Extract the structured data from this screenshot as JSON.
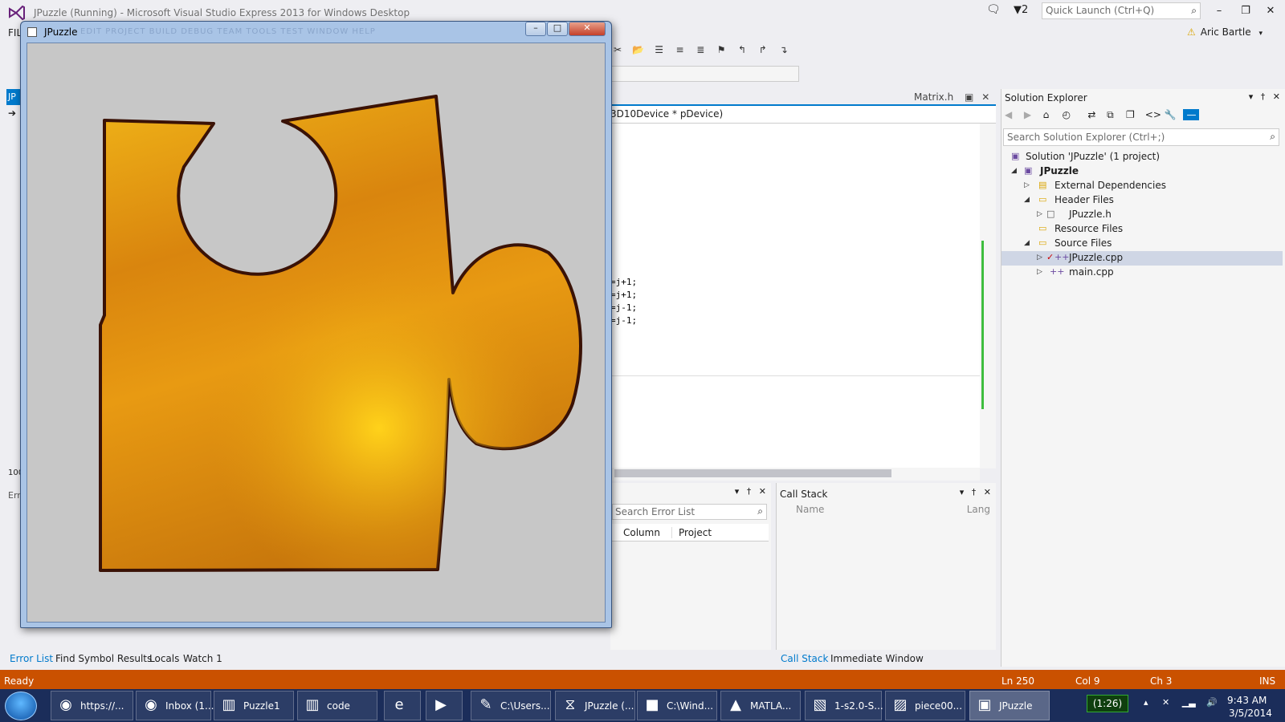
{
  "vs": {
    "title": "JPuzzle (Running) - Microsoft Visual Studio Express 2013 for Windows Desktop",
    "notifications_count": "2",
    "quick_launch_placeholder": "Quick Launch (Ctrl+Q)",
    "user_name": "Aric Bartle",
    "menu_file": "FIL",
    "editor_tab": "Matrix.h",
    "editor_nav": "3D10Device * pDevice)",
    "code_lines": [
      "=j+1;",
      "=j+1;",
      "=j-1;",
      "=j-1;"
    ],
    "left_fragment_1": "JP",
    "left_fragment_2": "100",
    "left_fragment_3": "Err"
  },
  "solution_explorer": {
    "title": "Solution Explorer",
    "search_placeholder": "Search Solution Explorer (Ctrl+;)",
    "items": [
      {
        "label": "Solution 'JPuzzle' (1 project)"
      },
      {
        "label": "JPuzzle"
      },
      {
        "label": "External Dependencies"
      },
      {
        "label": "Header Files"
      },
      {
        "label": "JPuzzle.h"
      },
      {
        "label": "Resource Files"
      },
      {
        "label": "Source Files"
      },
      {
        "label": "JPuzzle.cpp"
      },
      {
        "label": "main.cpp"
      }
    ]
  },
  "error_list": {
    "search_placeholder": "Search Error List",
    "columns": [
      "Column",
      "Project"
    ]
  },
  "call_stack": {
    "title": "Call Stack",
    "columns": [
      "Name",
      "Lang"
    ]
  },
  "bottom_tabs": [
    "Error List",
    "Find Symbol Results",
    "Locals",
    "Watch 1",
    "Call Stack",
    "Immediate Window"
  ],
  "status": {
    "ready": "Ready",
    "line": "Ln 250",
    "col": "Col 9",
    "ch": "Ch 3",
    "ins": "INS"
  },
  "app_window": {
    "title": "JPuzzle",
    "ghost_menu": "EDIT   PROJECT   BUILD   DEBUG   TEAM   TOOLS   TEST   WINDOW   HELP"
  },
  "taskbar": {
    "items": [
      {
        "label": "https://...",
        "icon": "chrome-icon"
      },
      {
        "label": "Inbox (1...",
        "icon": "chrome-icon"
      },
      {
        "label": "Puzzle1",
        "icon": "folder-icon"
      },
      {
        "label": "code",
        "icon": "folder-icon"
      },
      {
        "label": "",
        "icon": "ie-icon"
      },
      {
        "label": "",
        "icon": "media-icon"
      },
      {
        "label": "C:\\Users...",
        "icon": "editor-icon"
      },
      {
        "label": "JPuzzle (...",
        "icon": "visual-studio-icon"
      },
      {
        "label": "C:\\Wind...",
        "icon": "console-icon"
      },
      {
        "label": "MATLA...",
        "icon": "matlab-icon"
      },
      {
        "label": "1-s2.0-S...",
        "icon": "pdf-icon"
      },
      {
        "label": "piece00...",
        "icon": "image-viewer-icon"
      },
      {
        "label": "JPuzzle",
        "icon": "app-window-icon"
      }
    ],
    "battery": "(1:26)",
    "time": "9:43 AM",
    "date": "3/5/2014"
  },
  "colors": {
    "accent": "#007acc",
    "status_bar": "#ca5100",
    "taskbar": "#1b2d5a",
    "puzzle_fill": "#e8a317",
    "puzzle_outline": "#4a1608"
  }
}
